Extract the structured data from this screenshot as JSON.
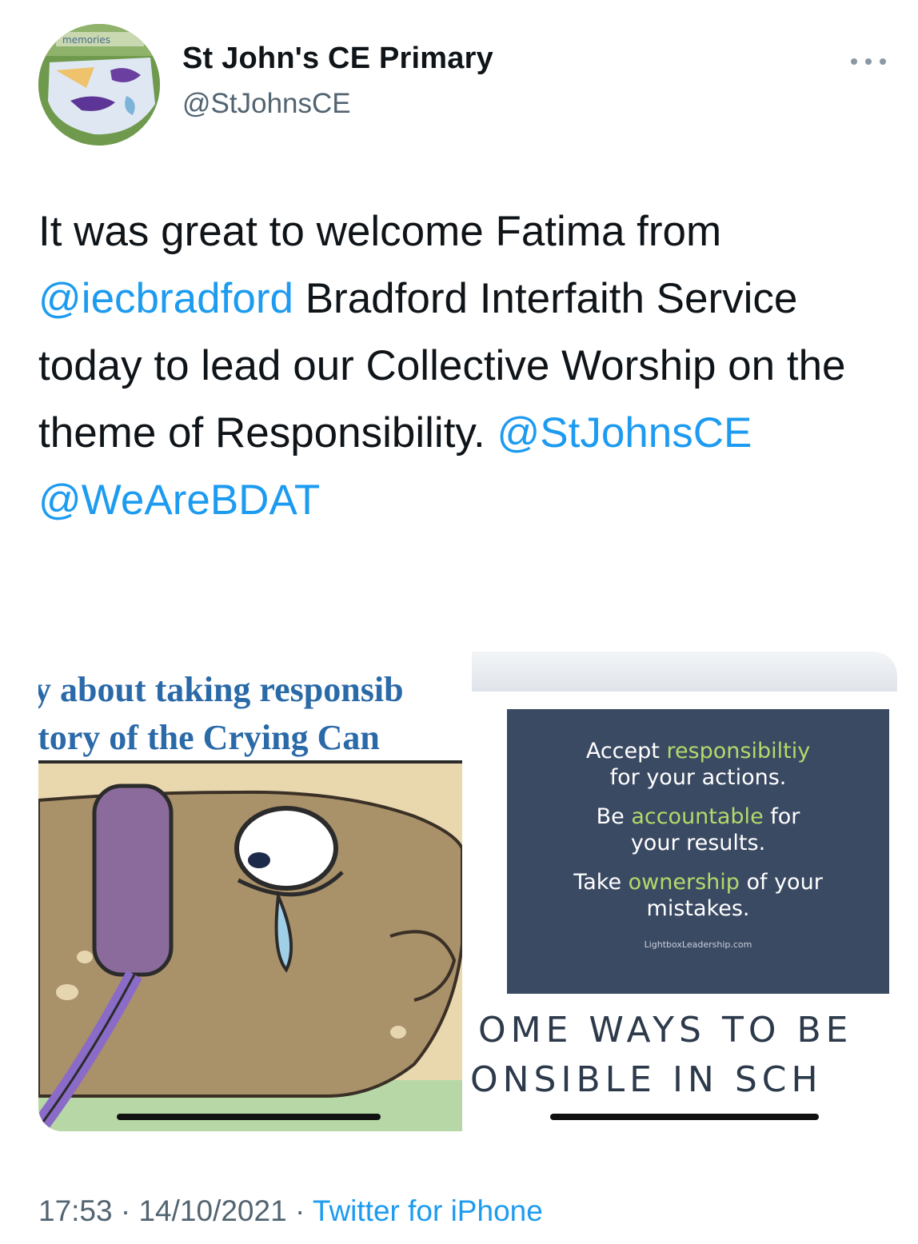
{
  "account": {
    "display_name": "St John's CE Primary",
    "handle": "@StJohnsCE",
    "avatar_label": "memories",
    "more_icon": "more-dots-icon"
  },
  "tweet": {
    "segments": [
      {
        "text": "It was great to welcome Fatima from ",
        "type": "text"
      },
      {
        "text": "@iecbradford",
        "type": "mention"
      },
      {
        "text": " Bradford Interfaith Service today to lead our Collective Worship on the theme of Responsibility. ",
        "type": "text"
      },
      {
        "text": "@StJohnsCE",
        "type": "mention"
      },
      {
        "text": " ",
        "type": "text"
      },
      {
        "text": "@WeAreBDAT",
        "type": "mention"
      }
    ]
  },
  "media": {
    "left": {
      "line1": "y about taking responsib",
      "line2": "story of the Crying Can"
    },
    "right": {
      "line1_pre": "Accept ",
      "line1_hl": "responsibiltiy",
      "line1_post": "for your actions.",
      "line2_pre": "Be ",
      "line2_hl": "accountable",
      "line2_mid": " for",
      "line2_post": "your results.",
      "line3_pre": "Take ",
      "line3_hl": "ownership",
      "line3_mid": " of your",
      "line3_post": "mistakes.",
      "site": "LightboxLeadership.com",
      "big1": "OME WAYS TO BE",
      "big2": "ONSIBLE IN SCH"
    }
  },
  "meta": {
    "time": "17:53",
    "sep1": " · ",
    "date": "14/10/2021",
    "sep2": " · ",
    "source": "Twitter for iPhone"
  },
  "colors": {
    "link": "#1d9bf0",
    "secondary": "#536471",
    "slate": "#3b4a63",
    "highlight": "#b4d96a"
  }
}
